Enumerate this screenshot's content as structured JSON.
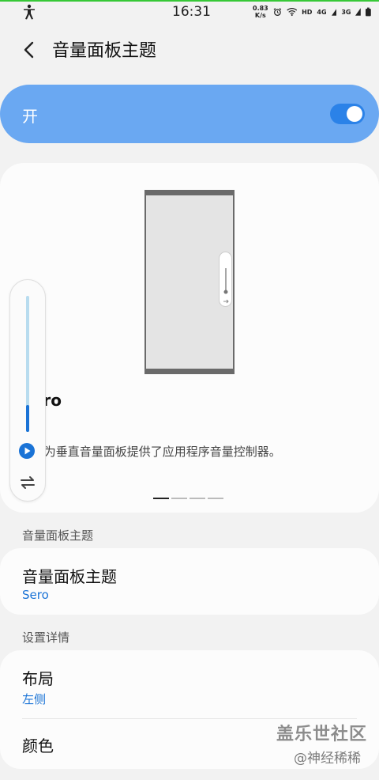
{
  "status_bar": {
    "time": "16:31",
    "net_speed_value": "0.83",
    "net_speed_unit": "K/s",
    "hd_label": "HD",
    "sig1_label": "4G",
    "sig2_label": "3G",
    "icons": [
      "accessibility-icon",
      "alarm-icon",
      "wifi-icon",
      "signal-icon",
      "battery-icon"
    ]
  },
  "header": {
    "title": "音量面板主题"
  },
  "master_toggle": {
    "label": "开",
    "on": true
  },
  "preview": {
    "heading": "Sero",
    "description": "Sero为垂直音量面板提供了应用程序音量控制器。",
    "volume_level": 0.2,
    "page_count": 4,
    "active_page": 1
  },
  "theme_section": {
    "label": "音量面板主题",
    "item_title": "音量面板主题",
    "item_value": "Sero"
  },
  "details_section": {
    "label": "设置详情",
    "layout_title": "布局",
    "layout_value": "左侧",
    "color_title": "颜色"
  },
  "watermark": {
    "line1": "盖乐世社区",
    "line2": "@神经稀稀"
  },
  "colors": {
    "accent": "#1a73d6",
    "toggle_card": "#6aa8f2",
    "background": "#f2f2f2"
  }
}
